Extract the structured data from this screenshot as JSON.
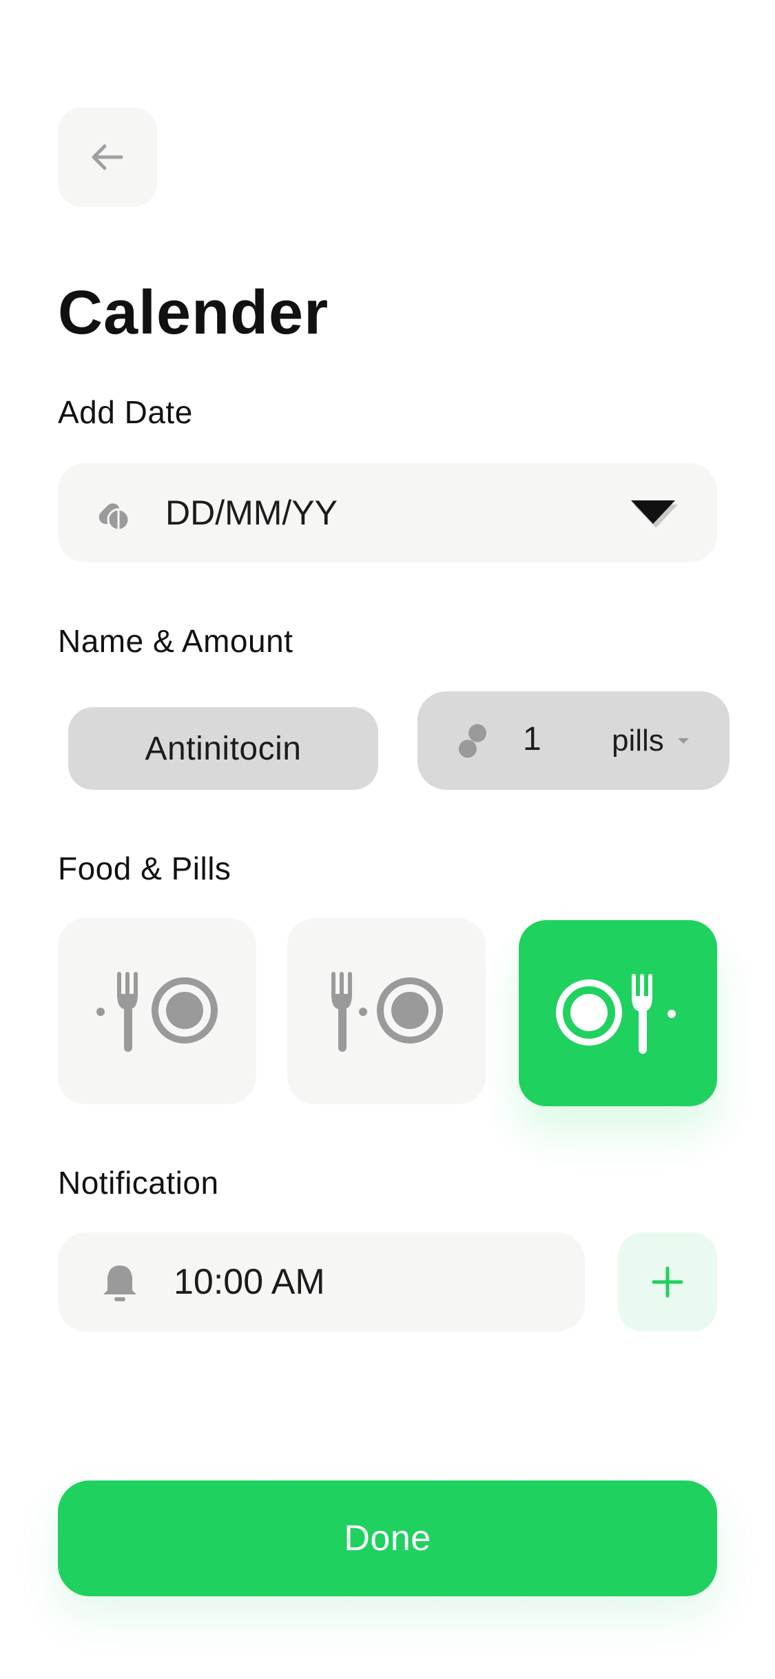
{
  "header": {
    "back_icon": "arrow-left-icon",
    "title": "Calender"
  },
  "date_section": {
    "label": "Add Date",
    "icon": "pill-capsule-icon",
    "placeholder": "DD/MM/YY",
    "dropdown_icon": "caret-down-icon"
  },
  "name_amount_section": {
    "label": "Name & Amount",
    "medicine_name": "Antinitocin",
    "amount": {
      "icon": "pills-icon",
      "value": "1",
      "unit": "pills",
      "unit_dropdown_icon": "caret-down-icon"
    }
  },
  "food_section": {
    "label": "Food & Pills",
    "options": [
      {
        "icon": "pill-before-meal-icon",
        "selected": false
      },
      {
        "icon": "pill-during-meal-icon",
        "selected": false
      },
      {
        "icon": "pill-after-meal-icon",
        "selected": true
      }
    ]
  },
  "notification_section": {
    "label": "Notification",
    "icon": "bell-icon",
    "time": "10:00 AM",
    "add_icon": "plus-icon"
  },
  "done_button": {
    "label": "Done"
  },
  "colors": {
    "accent": "#1fd15f",
    "field_bg": "#f6f6f4",
    "pill_bg": "#d9d9d9",
    "icon_gray": "#9a9a9a",
    "add_bg": "#ebfaf0"
  }
}
